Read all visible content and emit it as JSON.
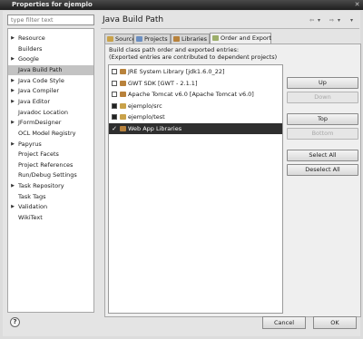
{
  "window": {
    "title": "Properties for ejemplo"
  },
  "filter": {
    "placeholder": "type filter text"
  },
  "tree": [
    {
      "label": "Resource",
      "expandable": true
    },
    {
      "label": "Builders",
      "expandable": false
    },
    {
      "label": "Google",
      "expandable": true
    },
    {
      "label": "Java Build Path",
      "expandable": false,
      "selected": true
    },
    {
      "label": "Java Code Style",
      "expandable": true
    },
    {
      "label": "Java Compiler",
      "expandable": true
    },
    {
      "label": "Java Editor",
      "expandable": true
    },
    {
      "label": "Javadoc Location",
      "expandable": false
    },
    {
      "label": "JFormDesigner",
      "expandable": true
    },
    {
      "label": "OCL Model Registry",
      "expandable": false
    },
    {
      "label": "Papyrus",
      "expandable": true
    },
    {
      "label": "Project Facets",
      "expandable": false
    },
    {
      "label": "Project References",
      "expandable": false
    },
    {
      "label": "Run/Debug Settings",
      "expandable": false
    },
    {
      "label": "Task Repository",
      "expandable": true
    },
    {
      "label": "Task Tags",
      "expandable": false
    },
    {
      "label": "Validation",
      "expandable": true
    },
    {
      "label": "WikiText",
      "expandable": false
    }
  ],
  "page": {
    "title": "Java Build Path"
  },
  "nav": {
    "back_icon": "arrow-left-icon",
    "forward_icon": "arrow-right-icon",
    "menu_icon": "chevron-down-icon"
  },
  "tabs": [
    {
      "label": "Source",
      "color": "#c9a24a",
      "active": false
    },
    {
      "label": "Projects",
      "color": "#6b8fc2",
      "active": false
    },
    {
      "label": "Libraries",
      "color": "#b8823c",
      "active": false
    },
    {
      "label": "Order and Export",
      "color": "#9cae6a",
      "active": true
    }
  ],
  "order": {
    "description_line1": "Build class path order and exported entries:",
    "description_line2": "(Exported entries are contributed to dependent projects)",
    "entries": [
      {
        "label": "JRE System Library [jdk1.6.0_22]",
        "checked": false,
        "icon_color": "#b8823c"
      },
      {
        "label": "GWT SDK [GWT - 2.1.1]",
        "checked": false,
        "icon_color": "#b8823c"
      },
      {
        "label": "Apache Tomcat v6.0 [Apache Tomcat v6.0]",
        "checked": false,
        "icon_color": "#b8823c"
      },
      {
        "label": "ejemplo/src",
        "checked": true,
        "icon_color": "#c9a24a"
      },
      {
        "label": "ejemplo/test",
        "checked": true,
        "icon_color": "#c9a24a"
      },
      {
        "label": "Web App Libraries",
        "checked": true,
        "icon_color": "#b8823c",
        "selected": true
      }
    ],
    "buttons": [
      {
        "label": "Up",
        "enabled": true
      },
      {
        "label": "Down",
        "enabled": false
      },
      {
        "label": "Top",
        "enabled": true
      },
      {
        "label": "Bottom",
        "enabled": false
      },
      {
        "label": "Select All",
        "enabled": true
      },
      {
        "label": "Deselect All",
        "enabled": true
      }
    ]
  },
  "dialog": {
    "help_label": "?",
    "cancel_label": "Cancel",
    "ok_label": "OK"
  }
}
